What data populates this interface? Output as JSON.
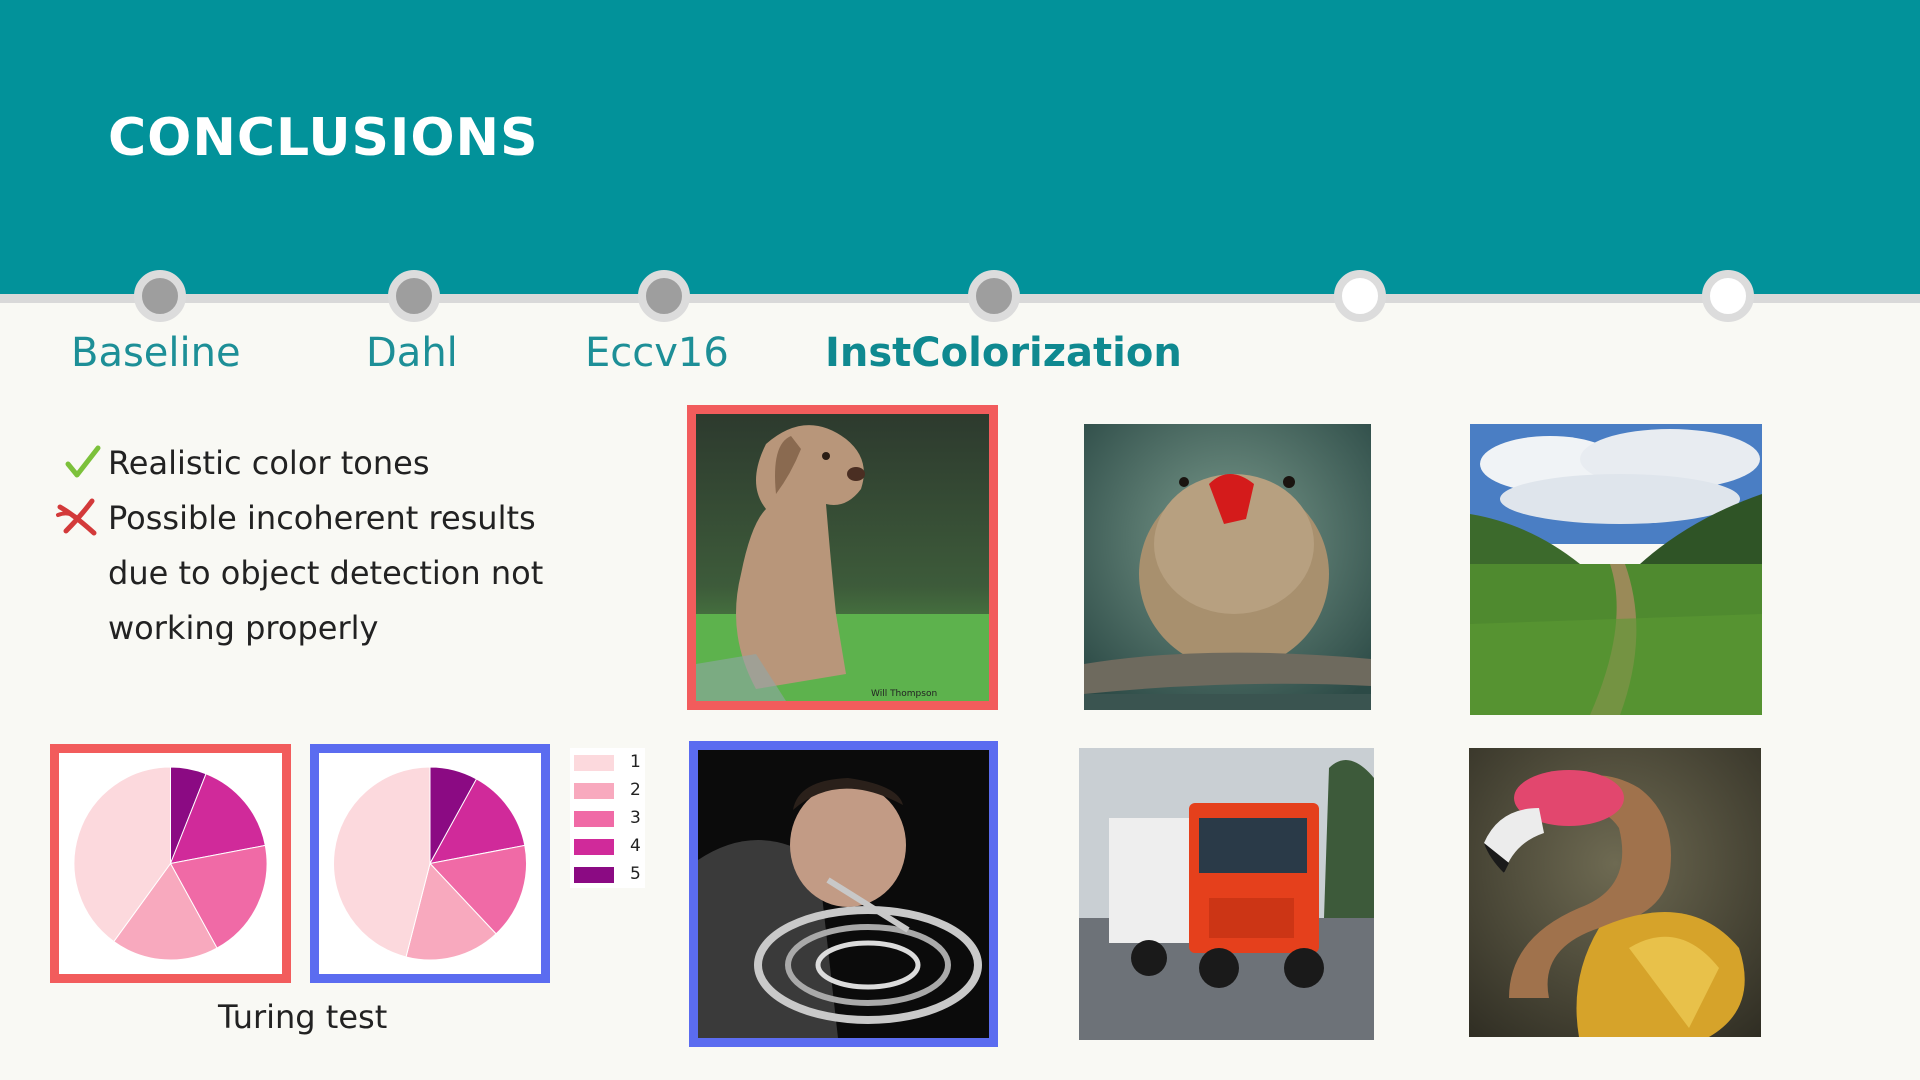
{
  "slide": {
    "title": "CONCLUSIONS",
    "colors": {
      "header": "#02929a",
      "accent": "#f25c5c",
      "accent2": "#5b6cf0"
    }
  },
  "timeline": {
    "steps": [
      {
        "label": "Baseline",
        "active": false
      },
      {
        "label": "Dahl",
        "active": false
      },
      {
        "label": "Eccv16",
        "active": false
      },
      {
        "label": "InstColorization",
        "active": true
      },
      {
        "label": "",
        "active": false
      },
      {
        "label": "",
        "active": false
      }
    ]
  },
  "bullets": [
    {
      "icon": "check-icon",
      "text": "Realistic color tones"
    },
    {
      "icon": "cross-icon",
      "text": "Possible incoherent results"
    },
    {
      "icon": "",
      "text": "due to object detection not"
    },
    {
      "icon": "",
      "text": "working properly"
    }
  ],
  "images": [
    {
      "name": "dog-photo",
      "watermark": "Will Thompson"
    },
    {
      "name": "bird-photo"
    },
    {
      "name": "landscape-photo"
    },
    {
      "name": "horn-player-photo"
    },
    {
      "name": "truck-photo"
    },
    {
      "name": "flamingo-photo"
    }
  ],
  "chart_data": [
    {
      "type": "pie",
      "title": "",
      "categories": [
        "1",
        "2",
        "3",
        "4",
        "5"
      ],
      "values": [
        40,
        18,
        20,
        16,
        6
      ],
      "colors": [
        "#fcd9dd",
        "#f8a9be",
        "#f06aa6",
        "#d02a9a",
        "#8b0a83"
      ]
    },
    {
      "type": "pie",
      "title": "",
      "categories": [
        "1",
        "2",
        "3",
        "4",
        "5"
      ],
      "values": [
        46,
        16,
        16,
        14,
        8
      ],
      "colors": [
        "#fcd9dd",
        "#f8a9be",
        "#f06aa6",
        "#d02a9a",
        "#8b0a83"
      ]
    }
  ],
  "legend": {
    "items": [
      {
        "label": "1",
        "color": "#fcd9dd"
      },
      {
        "label": "2",
        "color": "#f8a9be"
      },
      {
        "label": "3",
        "color": "#f06aa6"
      },
      {
        "label": "4",
        "color": "#d02a9a"
      },
      {
        "label": "5",
        "color": "#8b0a83"
      }
    ]
  },
  "caption": "Turing test"
}
